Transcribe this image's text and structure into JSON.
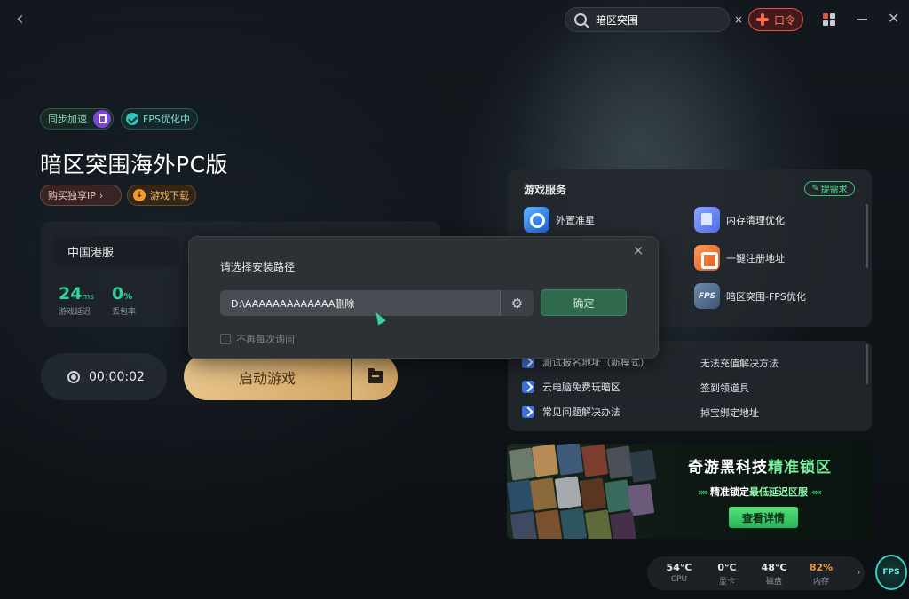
{
  "topbar": {
    "search_value": "暗区突围",
    "search_clear": "×",
    "kouling_label": "口令",
    "colors": {
      "kouling": "#e0523e"
    }
  },
  "game": {
    "sync_badge": "同步加速",
    "fps_badge": "FPS优化中",
    "title": "暗区突围海外PC版",
    "buy_ip": "购买独享IP",
    "buy_ip_arrow": "›",
    "download": "游戏下载",
    "server": "中国港服",
    "ping": {
      "value": "24",
      "unit": "ms",
      "label": "游戏延迟"
    },
    "loss": {
      "value": "0",
      "unit": "%",
      "label": "丢包率"
    },
    "timer": "00:00:02",
    "start_label": "启动游戏",
    "accent_color": "#31d39a"
  },
  "services": {
    "title": "游戏服务",
    "demand_label": "提需求",
    "items": [
      {
        "label": "外置准星",
        "icon": "crosshair-icon"
      },
      {
        "label": "内存清理优化",
        "icon": "memory-clean-icon"
      },
      {
        "label": "一键注册地址",
        "icon": "register-icon"
      },
      {
        "label": "暗区突围-FPS优化",
        "icon": "fps-optimize-icon",
        "icon_text": "FPS"
      }
    ]
  },
  "links": {
    "items": [
      {
        "label": "測试报名地址（新模式）",
        "icon": "link-icon"
      },
      {
        "label": "无法充值解决方法"
      },
      {
        "label": "云电脑免费玩暗区",
        "icon": "link-icon"
      },
      {
        "label": "签到领道具"
      },
      {
        "label": "常见问题解决办法",
        "icon": "link-icon"
      },
      {
        "label": "掉宝绑定地址"
      }
    ]
  },
  "banner": {
    "title_part1": "奇游黑科技",
    "title_part2": "精准锁区",
    "sub_prefix": "精准锁定",
    "sub_highlight": "最低延迟区服",
    "button": "查看详情"
  },
  "stats": [
    {
      "value": "54°C",
      "label": "CPU"
    },
    {
      "value": "0°C",
      "label": "显卡"
    },
    {
      "value": "48°C",
      "label": "磁盘"
    },
    {
      "value": "82%",
      "label": "内存",
      "warn": true
    }
  ],
  "stats_arrow": "›",
  "fps_orb": "FPS",
  "dialog": {
    "title": "请选择安装路径",
    "path_value": "D:\\AAAAAAAAAAAAA删除",
    "confirm": "确定",
    "checkbox_label": "不再每次询问",
    "close": "×"
  }
}
